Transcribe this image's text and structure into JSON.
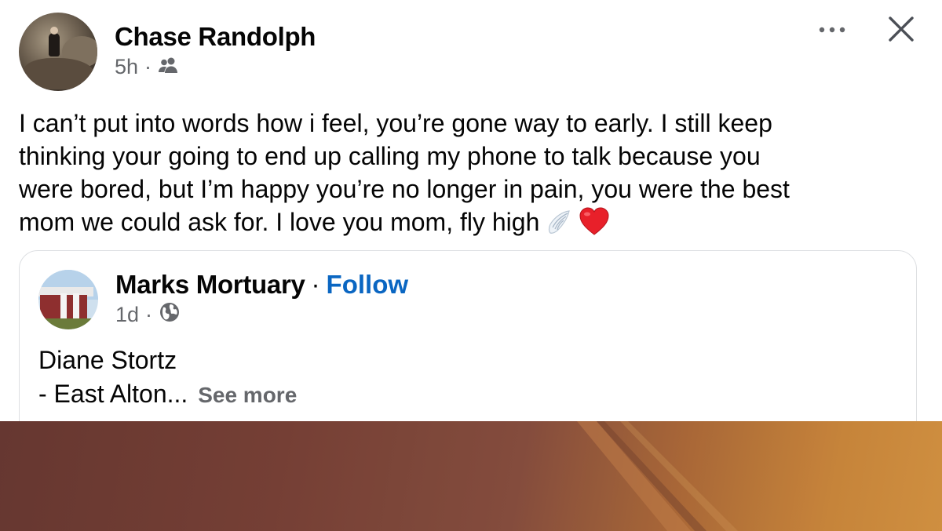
{
  "post": {
    "author": "Chase Randolph",
    "time": "5h",
    "audience_icon": "friends-icon",
    "text_lines": [
      "I can’t put into words how i feel, you’re gone way to early. I still keep",
      "thinking your going to end up calling my phone to talk because you",
      "were bored,  but I’m happy you’re no longer in pain, you were the best",
      "mom we could ask for. I love you mom, fly high"
    ],
    "emojis": [
      "wing-emoji",
      "red-heart-emoji"
    ]
  },
  "header_actions": {
    "more_label": "•••",
    "close_label": "✕"
  },
  "shared": {
    "page_name": "Mortuary",
    "page_name_full": "Marks Mortuary",
    "separator": "·",
    "follow_label": "Follow",
    "time": "1d",
    "audience_icon": "globe-icon",
    "text_line1": "Diane Stortz",
    "text_line2": "- East Alton...",
    "see_more_label": "See more"
  },
  "colors": {
    "link_blue": "#0a66c2",
    "meta_gray": "#65676b",
    "border": "#dddfe2"
  }
}
